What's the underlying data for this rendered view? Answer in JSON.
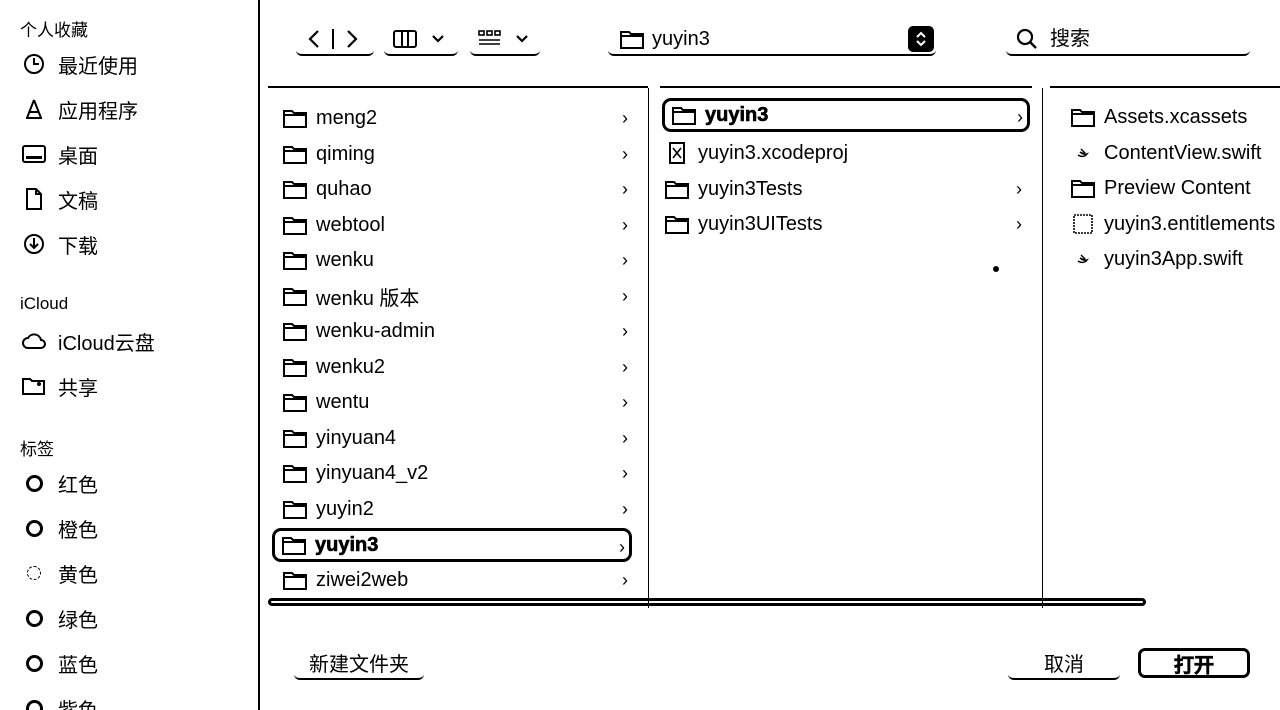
{
  "sidebar": {
    "favorites_heading": "个人收藏",
    "favorites": [
      {
        "label": "最近使用",
        "icon": "clock-icon"
      },
      {
        "label": "应用程序",
        "icon": "applications-icon"
      },
      {
        "label": "桌面",
        "icon": "desktop-icon"
      },
      {
        "label": "文稿",
        "icon": "document-icon"
      },
      {
        "label": "下载",
        "icon": "download-icon"
      }
    ],
    "icloud_heading": "iCloud",
    "icloud": [
      {
        "label": "iCloud云盘",
        "icon": "cloud-icon"
      },
      {
        "label": "共享",
        "icon": "shared-folder-icon"
      }
    ],
    "tags_heading": "标签",
    "tags": [
      {
        "label": "红色"
      },
      {
        "label": "橙色"
      },
      {
        "label": "黄色"
      },
      {
        "label": "绿色"
      },
      {
        "label": "蓝色"
      },
      {
        "label": "紫色"
      }
    ]
  },
  "toolbar": {
    "back_icon": "chevron-left-icon",
    "forward_icon": "chevron-right-icon",
    "view_mode_icon": "column-view-icon",
    "group_icon": "grid-view-icon",
    "path_label": "yuyin3",
    "search_placeholder": "搜索"
  },
  "columns": {
    "col1": [
      {
        "label": "meng2",
        "type": "folder"
      },
      {
        "label": "qiming",
        "type": "folder"
      },
      {
        "label": "quhao",
        "type": "folder"
      },
      {
        "label": "webtool",
        "type": "folder"
      },
      {
        "label": "wenku",
        "type": "folder"
      },
      {
        "label": "wenku 版本",
        "type": "folder"
      },
      {
        "label": "wenku-admin",
        "type": "folder"
      },
      {
        "label": "wenku2",
        "type": "folder"
      },
      {
        "label": "wentu",
        "type": "folder"
      },
      {
        "label": "yinyuan4",
        "type": "folder"
      },
      {
        "label": "yinyuan4_v2",
        "type": "folder"
      },
      {
        "label": "yuyin2",
        "type": "folder"
      },
      {
        "label": "yuyin3",
        "type": "folder",
        "selected": true
      },
      {
        "label": "ziwei2web",
        "type": "folder"
      }
    ],
    "col2": [
      {
        "label": "yuyin3",
        "type": "folder",
        "selected": true
      },
      {
        "label": "yuyin3.xcodeproj",
        "type": "xcodeproj"
      },
      {
        "label": "yuyin3Tests",
        "type": "folder"
      },
      {
        "label": "yuyin3UITests",
        "type": "folder"
      }
    ],
    "col3": [
      {
        "label": "Assets.xcassets",
        "type": "folder"
      },
      {
        "label": "ContentView.swift",
        "type": "swift"
      },
      {
        "label": "Preview Content",
        "type": "folder"
      },
      {
        "label": "yuyin3.entitlements",
        "type": "entitlements"
      },
      {
        "label": "yuyin3App.swift",
        "type": "swift"
      }
    ]
  },
  "footer": {
    "new_folder_label": "新建文件夹",
    "cancel_label": "取消",
    "open_label": "打开"
  }
}
